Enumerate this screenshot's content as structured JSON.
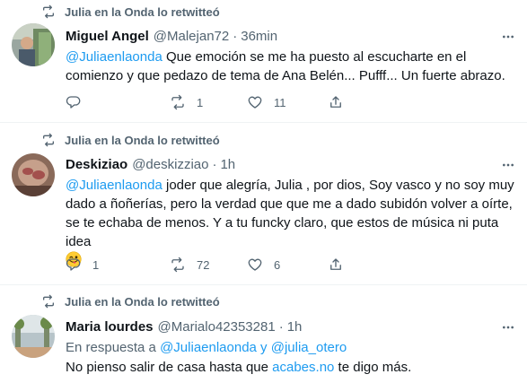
{
  "tweets": [
    {
      "retweeted_by": "Julia en la Onda lo retwitteó",
      "name": "Miguel Angel",
      "handle": "@Malejan72",
      "dot": "·",
      "time": "36min",
      "mention": "@Juliaenlaonda",
      "text": " Que emoción se me ha puesto al escucharte en el comienzo y que pedazo de tema de Ana Belén... Pufff... Un fuerte abrazo.",
      "replies": "",
      "retweets": "1",
      "likes": "11"
    },
    {
      "retweeted_by": "Julia en la Onda lo retwitteó",
      "name": "Deskiziao",
      "handle": "@deskizziao",
      "dot": "·",
      "time": "1h",
      "mention": "@Juliaenlaonda",
      "text": " joder que alegría, Julia , por dios, Soy vasco y no soy muy dado a ñoñerías, pero la verdad que que me a dado subidón volver a oírte, se te echaba de menos. Y a tu funcky claro, que estos de música ni puta idea",
      "emoji": "winking-face-with-tongue",
      "replies": "1",
      "retweets": "72",
      "likes": "6"
    },
    {
      "retweeted_by": "Julia en la Onda lo retwitteó",
      "name": "Maria lourdes",
      "handle": "@Marialo42353281",
      "dot": "·",
      "time": "1h",
      "reply_prefix": "En respuesta a ",
      "reply_to_1": "@Juliaenlaonda",
      "reply_and": " y ",
      "reply_to_2": "@julia_otero",
      "text_before": "No pienso salir de casa hasta que ",
      "text_link": "acabes.no",
      "text_after": " te digo más."
    }
  ],
  "colors": {
    "link": "#1d9bf0",
    "muted": "#536471",
    "text": "#0f1419",
    "divider": "#eff3f4"
  }
}
